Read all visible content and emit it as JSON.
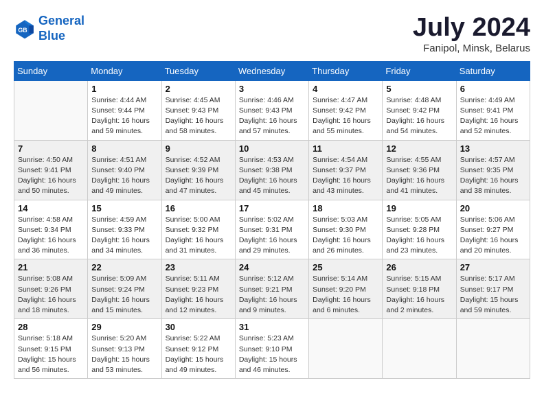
{
  "header": {
    "logo_line1": "General",
    "logo_line2": "Blue",
    "month_title": "July 2024",
    "subtitle": "Fanipol, Minsk, Belarus"
  },
  "weekdays": [
    "Sunday",
    "Monday",
    "Tuesday",
    "Wednesday",
    "Thursday",
    "Friday",
    "Saturday"
  ],
  "weeks": [
    [
      {
        "day": "",
        "info": ""
      },
      {
        "day": "1",
        "info": "Sunrise: 4:44 AM\nSunset: 9:44 PM\nDaylight: 16 hours\nand 59 minutes."
      },
      {
        "day": "2",
        "info": "Sunrise: 4:45 AM\nSunset: 9:43 PM\nDaylight: 16 hours\nand 58 minutes."
      },
      {
        "day": "3",
        "info": "Sunrise: 4:46 AM\nSunset: 9:43 PM\nDaylight: 16 hours\nand 57 minutes."
      },
      {
        "day": "4",
        "info": "Sunrise: 4:47 AM\nSunset: 9:42 PM\nDaylight: 16 hours\nand 55 minutes."
      },
      {
        "day": "5",
        "info": "Sunrise: 4:48 AM\nSunset: 9:42 PM\nDaylight: 16 hours\nand 54 minutes."
      },
      {
        "day": "6",
        "info": "Sunrise: 4:49 AM\nSunset: 9:41 PM\nDaylight: 16 hours\nand 52 minutes."
      }
    ],
    [
      {
        "day": "7",
        "info": "Sunrise: 4:50 AM\nSunset: 9:41 PM\nDaylight: 16 hours\nand 50 minutes."
      },
      {
        "day": "8",
        "info": "Sunrise: 4:51 AM\nSunset: 9:40 PM\nDaylight: 16 hours\nand 49 minutes."
      },
      {
        "day": "9",
        "info": "Sunrise: 4:52 AM\nSunset: 9:39 PM\nDaylight: 16 hours\nand 47 minutes."
      },
      {
        "day": "10",
        "info": "Sunrise: 4:53 AM\nSunset: 9:38 PM\nDaylight: 16 hours\nand 45 minutes."
      },
      {
        "day": "11",
        "info": "Sunrise: 4:54 AM\nSunset: 9:37 PM\nDaylight: 16 hours\nand 43 minutes."
      },
      {
        "day": "12",
        "info": "Sunrise: 4:55 AM\nSunset: 9:36 PM\nDaylight: 16 hours\nand 41 minutes."
      },
      {
        "day": "13",
        "info": "Sunrise: 4:57 AM\nSunset: 9:35 PM\nDaylight: 16 hours\nand 38 minutes."
      }
    ],
    [
      {
        "day": "14",
        "info": "Sunrise: 4:58 AM\nSunset: 9:34 PM\nDaylight: 16 hours\nand 36 minutes."
      },
      {
        "day": "15",
        "info": "Sunrise: 4:59 AM\nSunset: 9:33 PM\nDaylight: 16 hours\nand 34 minutes."
      },
      {
        "day": "16",
        "info": "Sunrise: 5:00 AM\nSunset: 9:32 PM\nDaylight: 16 hours\nand 31 minutes."
      },
      {
        "day": "17",
        "info": "Sunrise: 5:02 AM\nSunset: 9:31 PM\nDaylight: 16 hours\nand 29 minutes."
      },
      {
        "day": "18",
        "info": "Sunrise: 5:03 AM\nSunset: 9:30 PM\nDaylight: 16 hours\nand 26 minutes."
      },
      {
        "day": "19",
        "info": "Sunrise: 5:05 AM\nSunset: 9:28 PM\nDaylight: 16 hours\nand 23 minutes."
      },
      {
        "day": "20",
        "info": "Sunrise: 5:06 AM\nSunset: 9:27 PM\nDaylight: 16 hours\nand 20 minutes."
      }
    ],
    [
      {
        "day": "21",
        "info": "Sunrise: 5:08 AM\nSunset: 9:26 PM\nDaylight: 16 hours\nand 18 minutes."
      },
      {
        "day": "22",
        "info": "Sunrise: 5:09 AM\nSunset: 9:24 PM\nDaylight: 16 hours\nand 15 minutes."
      },
      {
        "day": "23",
        "info": "Sunrise: 5:11 AM\nSunset: 9:23 PM\nDaylight: 16 hours\nand 12 minutes."
      },
      {
        "day": "24",
        "info": "Sunrise: 5:12 AM\nSunset: 9:21 PM\nDaylight: 16 hours\nand 9 minutes."
      },
      {
        "day": "25",
        "info": "Sunrise: 5:14 AM\nSunset: 9:20 PM\nDaylight: 16 hours\nand 6 minutes."
      },
      {
        "day": "26",
        "info": "Sunrise: 5:15 AM\nSunset: 9:18 PM\nDaylight: 16 hours\nand 2 minutes."
      },
      {
        "day": "27",
        "info": "Sunrise: 5:17 AM\nSunset: 9:17 PM\nDaylight: 15 hours\nand 59 minutes."
      }
    ],
    [
      {
        "day": "28",
        "info": "Sunrise: 5:18 AM\nSunset: 9:15 PM\nDaylight: 15 hours\nand 56 minutes."
      },
      {
        "day": "29",
        "info": "Sunrise: 5:20 AM\nSunset: 9:13 PM\nDaylight: 15 hours\nand 53 minutes."
      },
      {
        "day": "30",
        "info": "Sunrise: 5:22 AM\nSunset: 9:12 PM\nDaylight: 15 hours\nand 49 minutes."
      },
      {
        "day": "31",
        "info": "Sunrise: 5:23 AM\nSunset: 9:10 PM\nDaylight: 15 hours\nand 46 minutes."
      },
      {
        "day": "",
        "info": ""
      },
      {
        "day": "",
        "info": ""
      },
      {
        "day": "",
        "info": ""
      }
    ]
  ]
}
